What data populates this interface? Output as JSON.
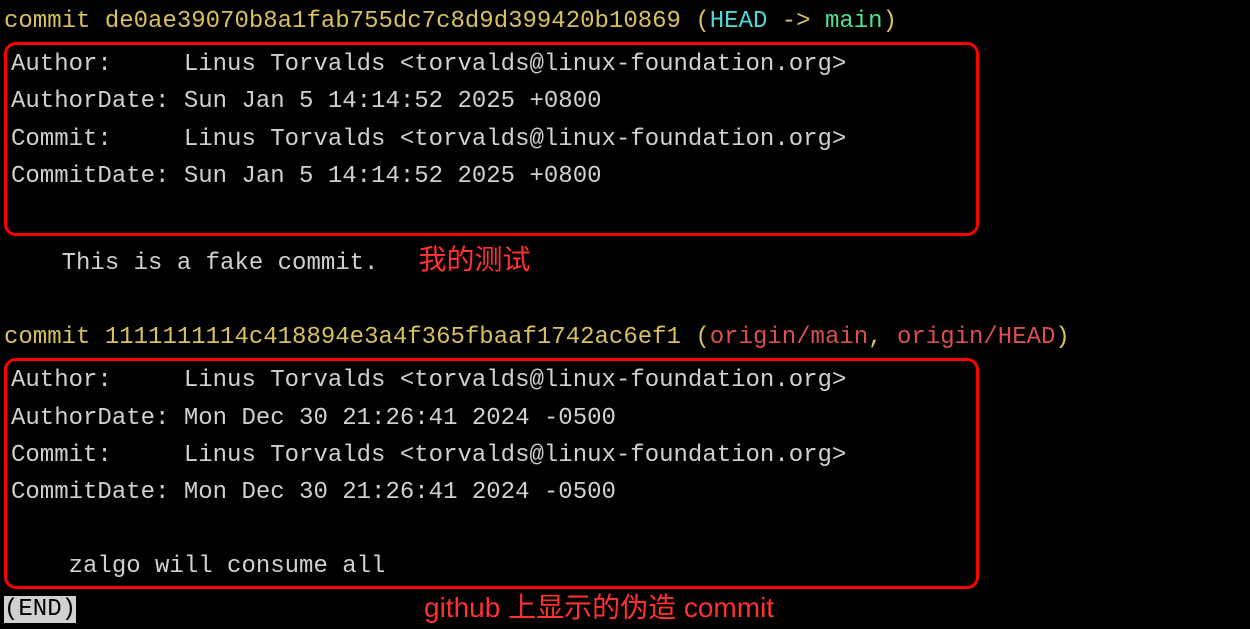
{
  "commits": [
    {
      "commit_word": "commit ",
      "hash": "de0ae39070b8a1fab755dc7c8d9d399420b10869",
      "refs": {
        "open": " (",
        "head": "HEAD",
        "arrow": " -> ",
        "main": "main",
        "close": ")"
      },
      "author_label": "Author:     ",
      "author_value": "Linus Torvalds <torvalds@linux-foundation.org>",
      "author_date_label": "AuthorDate: ",
      "author_date_value": "Sun Jan 5 14:14:52 2025 +0800",
      "commit_label": "Commit:     ",
      "commit_value": "Linus Torvalds <torvalds@linux-foundation.org>",
      "commit_date_label": "CommitDate: ",
      "commit_date_value": "Sun Jan 5 14:14:52 2025 +0800",
      "message_indent": "    ",
      "message": "This is a fake commit.",
      "annotation": "我的测试"
    },
    {
      "commit_word": "commit ",
      "hash": "1111111114c418894e3a4f365fbaaf1742ac6ef1",
      "refs": {
        "open": " (",
        "origin_main": "origin/main",
        "comma": ", ",
        "origin_head": "origin/HEAD",
        "close": ")"
      },
      "author_label": "Author:     ",
      "author_value": "Linus Torvalds <torvalds@linux-foundation.org>",
      "author_date_label": "AuthorDate: ",
      "author_date_value": "Mon Dec 30 21:26:41 2024 -0500",
      "commit_label": "Commit:     ",
      "commit_value": "Linus Torvalds <torvalds@linux-foundation.org>",
      "commit_date_label": "CommitDate: ",
      "commit_date_value": "Mon Dec 30 21:26:41 2024 -0500",
      "message_indent": "    ",
      "message": "zalgo will consume all",
      "annotation": "github 上显示的伪造 commit"
    }
  ],
  "end_marker": "(END)"
}
